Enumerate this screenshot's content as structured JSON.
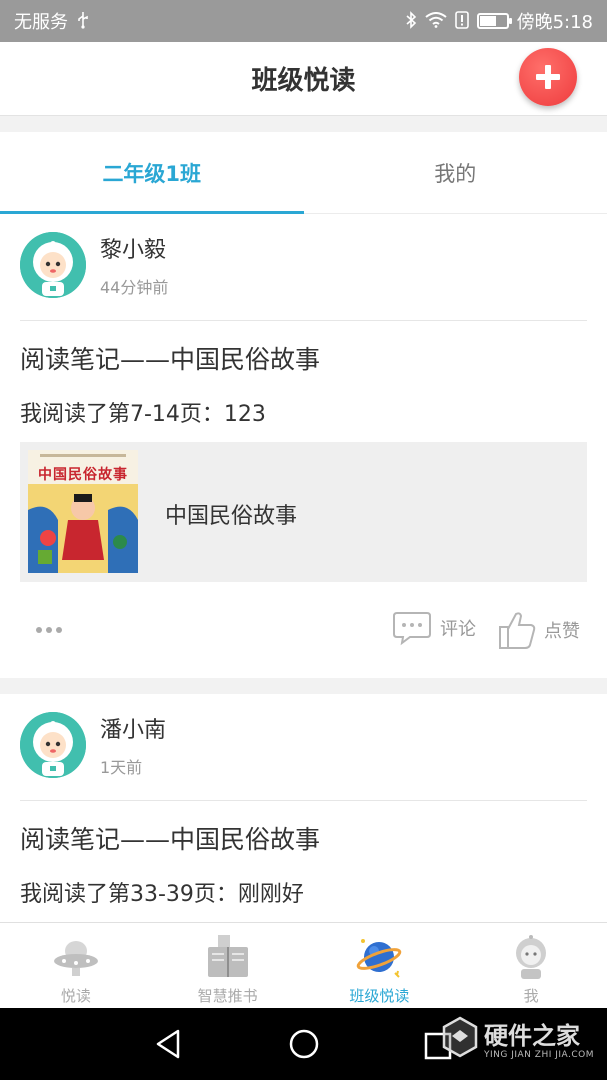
{
  "status_bar": {
    "carrier": "无服务",
    "usb_icon": "usb-icon",
    "time_label": "傍晚5:18",
    "icons": [
      "bluetooth-icon",
      "wifi-icon",
      "alert-icon",
      "battery-icon"
    ]
  },
  "header": {
    "title": "班级悦读",
    "add_button_icon": "plus-icon",
    "accent_color": "#ee3b3d"
  },
  "tabs": [
    {
      "label": "二年级1班",
      "active": true
    },
    {
      "label": "我的",
      "active": false
    }
  ],
  "posts": [
    {
      "user_name": "黎小毅",
      "time": "44分钟前",
      "title": "阅读笔记——中国民俗故事",
      "body": "我阅读了第7-14页：123",
      "book": {
        "cover_title": "中国民俗故事",
        "title": "中国民俗故事"
      },
      "actions": {
        "comment": "评论",
        "like": "点赞"
      }
    },
    {
      "user_name": "潘小南",
      "time": "1天前",
      "title": "阅读笔记——中国民俗故事",
      "body": "我阅读了第33-39页：刚刚好"
    }
  ],
  "tabbar": [
    {
      "label": "悦读",
      "icon": "ufo-icon",
      "active": false
    },
    {
      "label": "智慧推书",
      "icon": "book-icon",
      "active": false
    },
    {
      "label": "班级悦读",
      "icon": "planet-icon",
      "active": true
    },
    {
      "label": "我",
      "icon": "robot-icon",
      "active": false
    }
  ],
  "watermark": {
    "title": "硬件之家",
    "subtitle": "YING JIAN ZHI JIA.COM"
  },
  "colors": {
    "primary": "#2aa7d4",
    "avatar_bg": "#41bfae"
  }
}
